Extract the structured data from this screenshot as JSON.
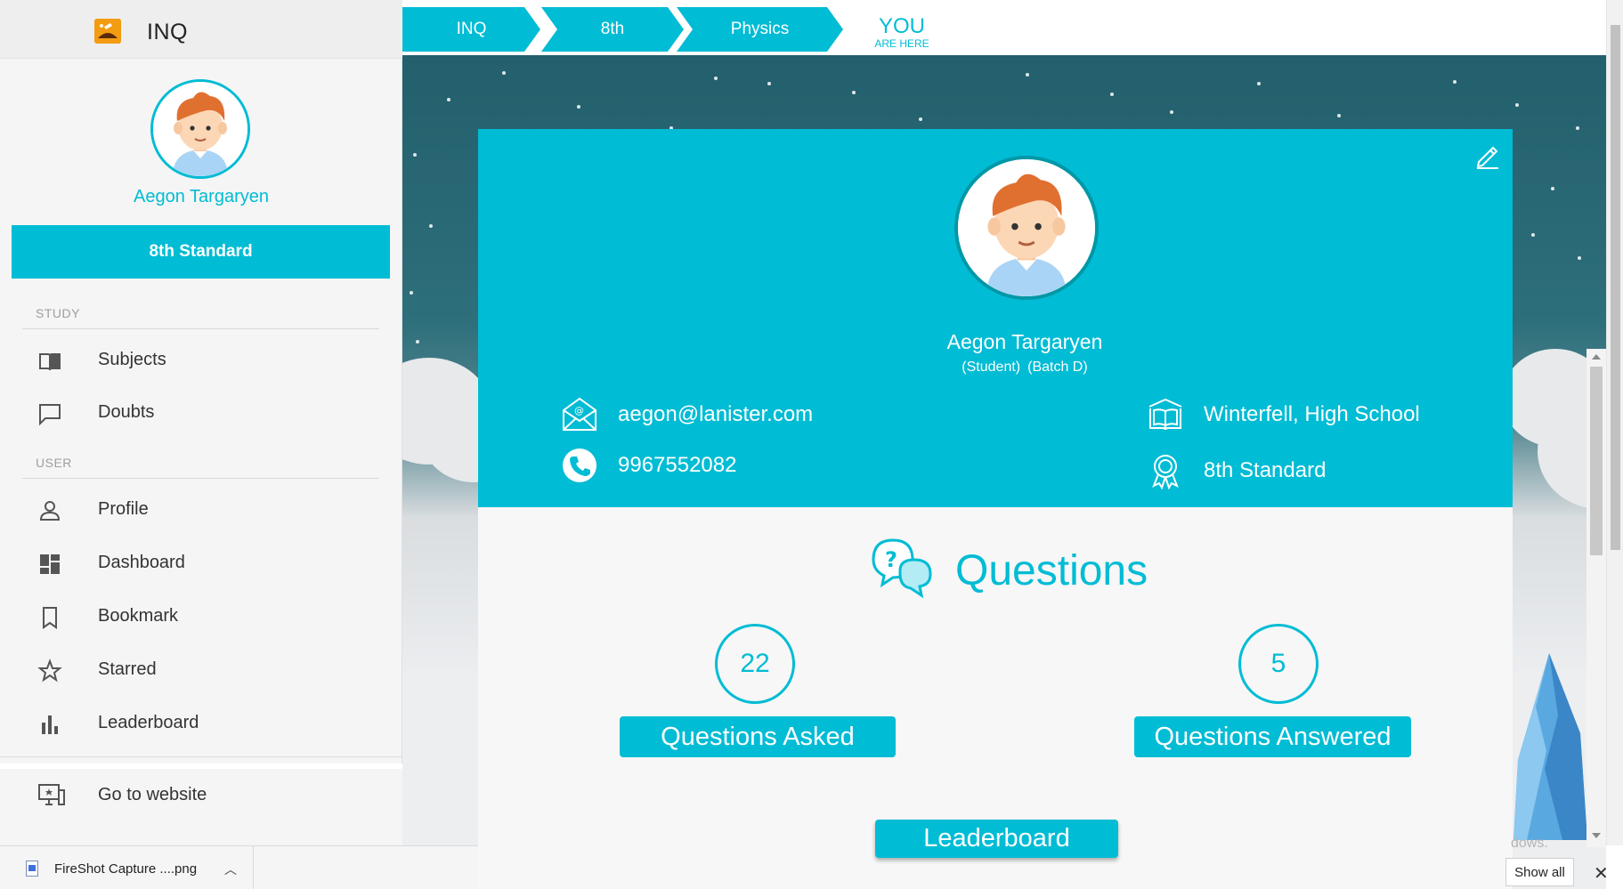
{
  "app": {
    "title": "INQ"
  },
  "sidebar": {
    "user_name": "Aegon Targaryen",
    "standard": "8th Standard",
    "sections": {
      "study": "STUDY",
      "user": "USER"
    },
    "items": [
      {
        "label": "Subjects",
        "icon": "book-icon"
      },
      {
        "label": "Doubts",
        "icon": "chat-icon"
      },
      {
        "label": "Profile",
        "icon": "person-icon"
      },
      {
        "label": "Dashboard",
        "icon": "dashboard-icon"
      },
      {
        "label": "Bookmark",
        "icon": "bookmark-icon"
      },
      {
        "label": "Starred",
        "icon": "star-icon"
      },
      {
        "label": "Leaderboard",
        "icon": "bar-chart-icon"
      },
      {
        "label": "Go to website",
        "icon": "website-icon"
      }
    ]
  },
  "breadcrumb": {
    "items": [
      "INQ",
      "8th",
      "Physics"
    ],
    "you": "YOU",
    "are_here": "ARE HERE"
  },
  "profile": {
    "name": "Aegon Targaryen",
    "role": "(Student)",
    "batch": "(Batch D)",
    "email": "aegon@lanister.com",
    "phone": "9967552082",
    "school": "Winterfell, High School",
    "standard": "8th Standard"
  },
  "questions": {
    "title": "Questions",
    "asked_count": "22",
    "asked_label": "Questions Asked",
    "answered_count": "5",
    "answered_label": "Questions Answered",
    "leaderboard_label": "Leaderboard"
  },
  "downloads": {
    "file_name": "FireShot Capture ....png",
    "show_all": "Show all",
    "close": "✕"
  },
  "watermark": "dows.",
  "colors": {
    "accent": "#00bcd4",
    "sidebar_bg": "#f5f5f5"
  }
}
